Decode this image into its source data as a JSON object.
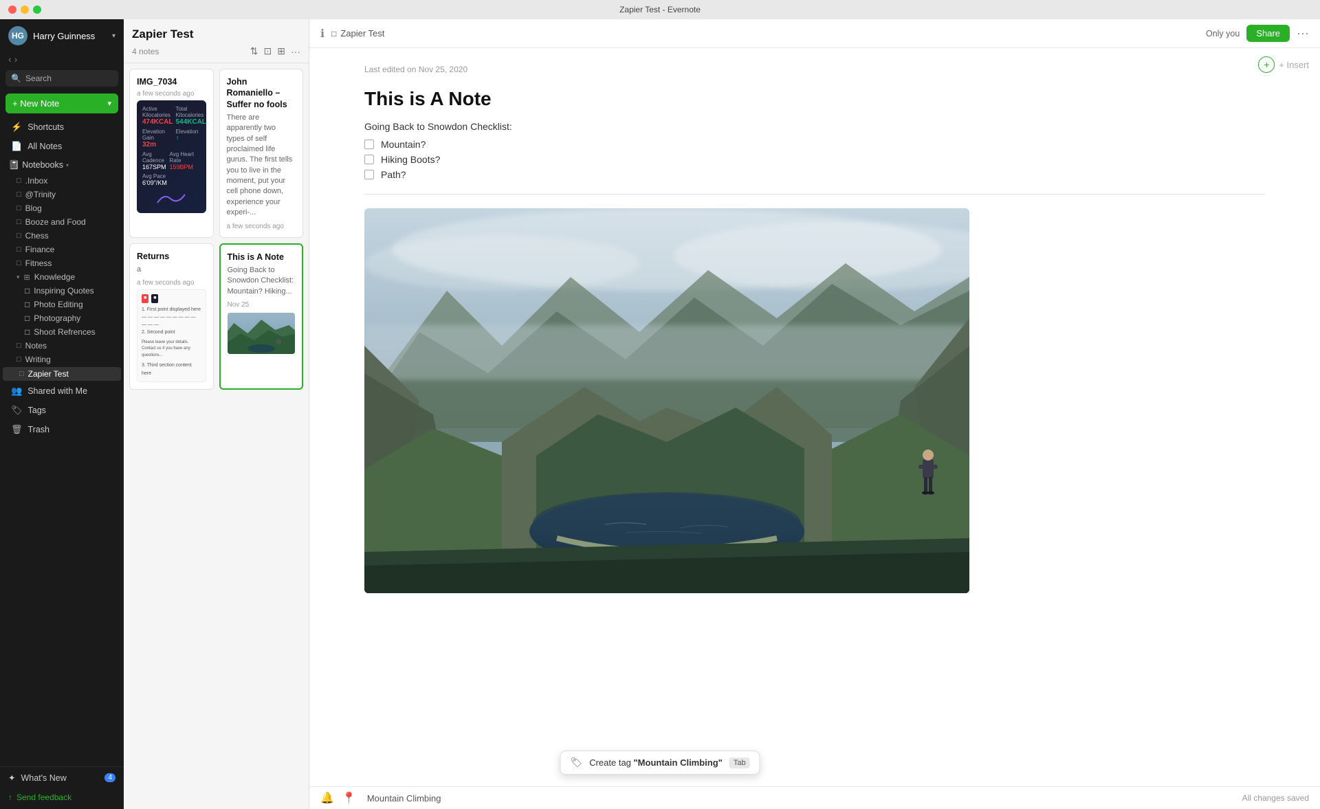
{
  "window": {
    "title": "Zapier Test - Evernote"
  },
  "sidebar": {
    "user": {
      "name": "Harry Guinness",
      "initials": "HG"
    },
    "search_placeholder": "Search",
    "new_note_label": "+ New Note",
    "shortcuts_label": "Shortcuts",
    "all_notes_label": "All Notes",
    "notebooks_label": "Notebooks",
    "notebooks": [
      {
        "name": ".Inbox",
        "indent": 1
      },
      {
        "name": "@Trinity",
        "indent": 1
      },
      {
        "name": "Blog",
        "indent": 1
      },
      {
        "name": "Booze and Food",
        "indent": 1
      },
      {
        "name": "Chess",
        "indent": 1
      },
      {
        "name": "Finance",
        "indent": 1
      },
      {
        "name": "Fitness",
        "indent": 1
      },
      {
        "name": "Knowledge",
        "indent": 1,
        "expanded": true
      },
      {
        "name": "Inspiring Quotes",
        "indent": 2
      },
      {
        "name": "Photo Editing",
        "indent": 2
      },
      {
        "name": "Photography",
        "indent": 2
      },
      {
        "name": "Shoot Refrences",
        "indent": 2
      },
      {
        "name": "Notes",
        "indent": 1
      },
      {
        "name": "Writing",
        "indent": 1
      },
      {
        "name": "Zapier Test",
        "indent": 1,
        "active": true
      }
    ],
    "shared_with_me": "Shared with Me",
    "tags_label": "Tags",
    "trash_label": "Trash",
    "whats_new_label": "What's New",
    "whats_new_badge": "4",
    "send_feedback_label": "Send feedback"
  },
  "notes_panel": {
    "title": "Zapier Test",
    "count": "4 notes",
    "notes": [
      {
        "id": "img7034",
        "title": "IMG_7034",
        "time": "a few seconds ago",
        "has_fitness_img": true,
        "selected": false
      },
      {
        "id": "john",
        "title": "John Romaniello – Suffer no fools",
        "preview": "There are apparently two types of self proclaimed life gurus. The first tells you to live in the moment, put your cell phone down, experience your experi-...",
        "time": "a few seconds ago",
        "selected": false
      },
      {
        "id": "returns",
        "title": "Returns",
        "preview": "a",
        "time": "a few seconds ago",
        "has_doc_img": true,
        "selected": false
      },
      {
        "id": "this-is-a-note",
        "title": "This is A Note",
        "preview": "Going Back to Snowdon Checklist: Mountain? Hiking...",
        "time": "Nov 25",
        "has_mountain_thumb": true,
        "selected": true
      }
    ]
  },
  "main": {
    "breadcrumb_notebook": "Zapier Test",
    "only_you": "Only you",
    "share_label": "Share",
    "insert_label": "+ Insert",
    "last_edited": "Last edited on Nov 25, 2020",
    "note_title": "This is A Note",
    "checklist_label": "Going Back to Snowdon Checklist:",
    "checklist_items": [
      {
        "text": "Mountain?",
        "checked": false
      },
      {
        "text": "Hiking Boots?",
        "checked": false
      },
      {
        "text": "Path?",
        "checked": false
      }
    ],
    "tag_suggestion": "Create tag \"Mountain Climbing\"",
    "tab_label": "Tab",
    "tag_input_value": "Mountain Climbing",
    "all_changes_saved": "All changes saved"
  }
}
